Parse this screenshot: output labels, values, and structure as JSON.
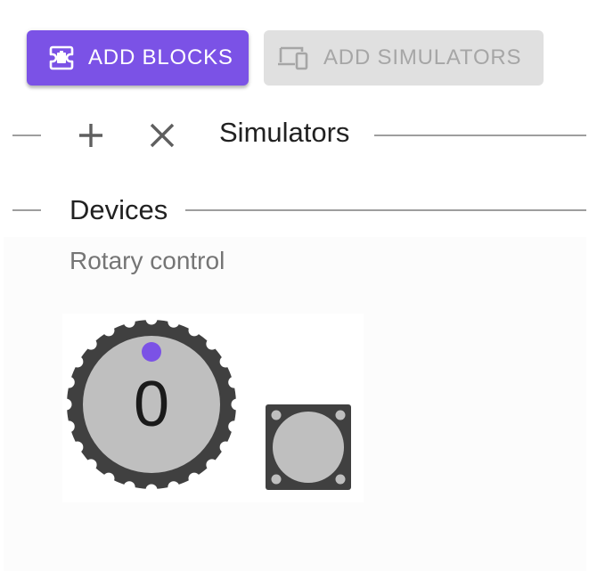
{
  "toolbar": {
    "add_blocks_label": "Add blocks",
    "add_simulators_label": "Add simulators"
  },
  "simulators_section": {
    "title": "Simulators"
  },
  "devices_section": {
    "title": "Devices",
    "device_label": "Rotary control",
    "rotary_value": "0"
  },
  "colors": {
    "accent": "#7b52e6",
    "disabled_bg": "#e0e0e0",
    "disabled_text": "#a6a6a6",
    "knob_body": "#404040",
    "knob_face": "#bfbfbf"
  },
  "icons": {
    "add_blocks": "puzzle-block-icon",
    "add_simulators": "devices-icon",
    "add": "plus-icon",
    "close": "close-icon"
  }
}
